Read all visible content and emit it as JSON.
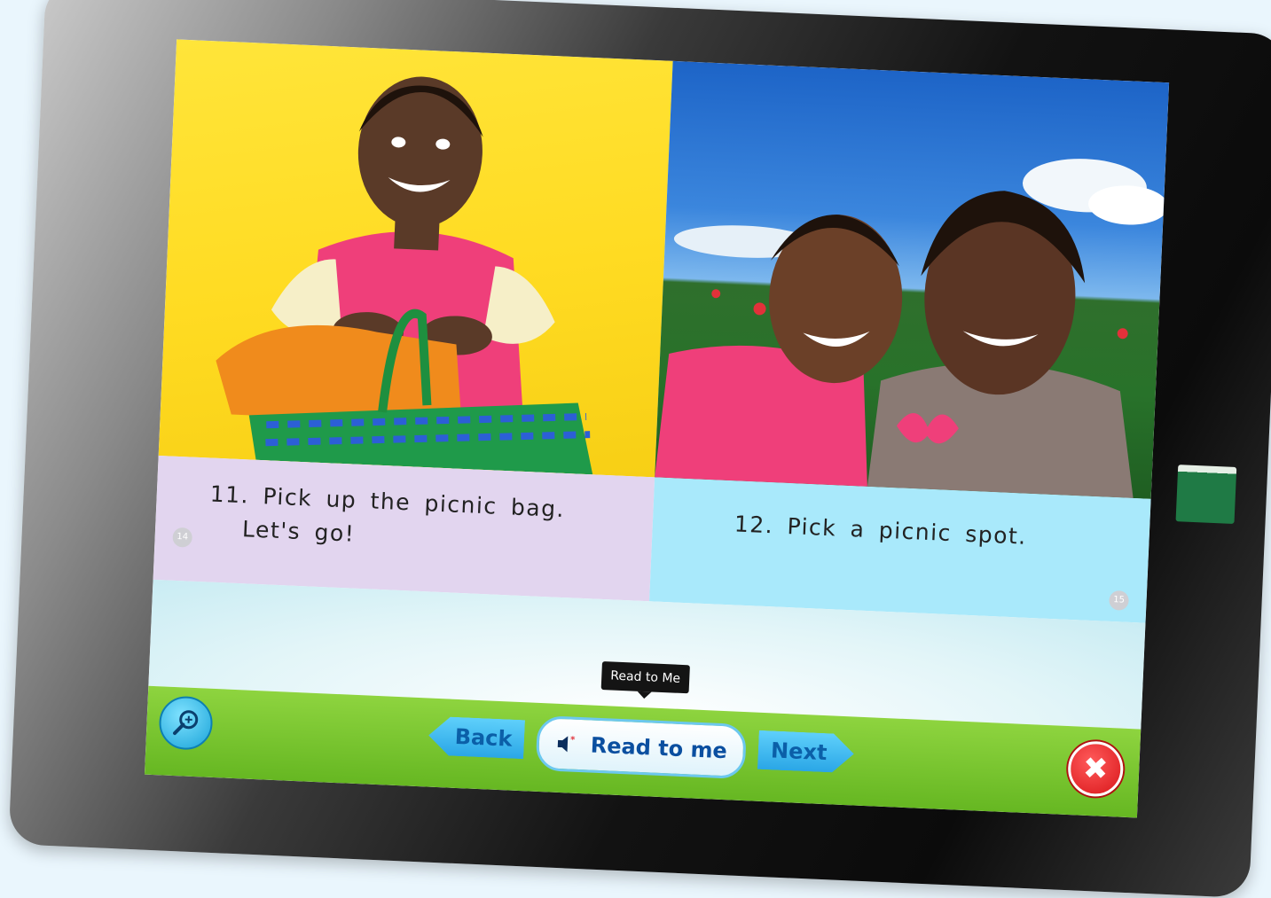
{
  "book": {
    "left_page": {
      "text_line1": "11. Pick up the picnic bag.",
      "text_line2": "Let's go!",
      "page_number": "14"
    },
    "right_page": {
      "text_line1": "12. Pick a picnic spot.",
      "page_number": "15"
    }
  },
  "toolbar": {
    "back_label": "Back",
    "read_label": "Read to me",
    "next_label": "Next",
    "tooltip": "Read to Me"
  },
  "icons": {
    "zoom": "zoom-in-icon",
    "speaker": "speaker-icon",
    "close": "close-icon"
  },
  "colors": {
    "toolbar_green": "#66b722",
    "button_blue": "#2aa6e6",
    "close_red": "#d9161a",
    "left_text_bg": "#e2d5ef",
    "right_text_bg": "#a9e9fb"
  }
}
